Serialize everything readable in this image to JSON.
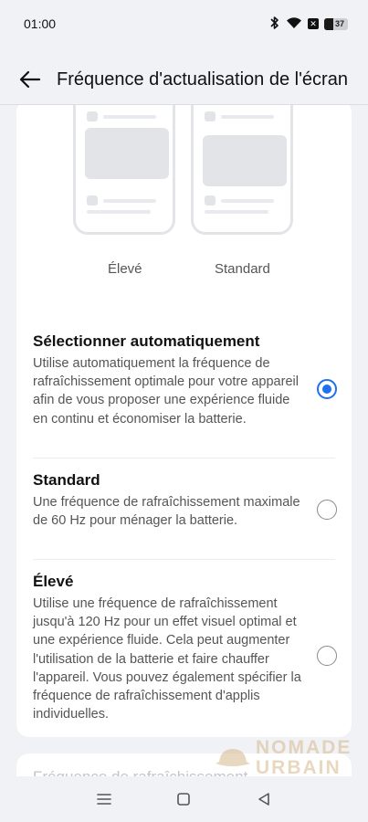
{
  "status_bar": {
    "time": "01:00",
    "battery_level": "37",
    "icons": [
      "bluetooth-icon",
      "wifi-icon",
      "close-box-icon",
      "battery-icon"
    ]
  },
  "header": {
    "back_icon": "arrow-left-icon",
    "title": "Fréquence d'actualisation de l'écran"
  },
  "preview": {
    "labels": [
      "Élevé",
      "Standard"
    ]
  },
  "options": [
    {
      "title": "Sélectionner automatiquement",
      "description": "Utilise automatiquement la fréquence de rafraîchissement optimale pour votre appareil afin de vous proposer une expérience fluide en continu et économiser la batterie.",
      "selected": true
    },
    {
      "title": "Standard",
      "description": "Une fréquence de rafraîchissement maximale de 60 Hz pour ménager la batterie.",
      "selected": false
    },
    {
      "title": "Élevé",
      "description": "Utilise une fréquence de rafraîchissement jusqu'à 120 Hz pour un effet visuel optimal et une expérience fluide. Cela peut augmenter l'utilisation de la batterie et faire chauffer l'appareil. Vous pouvez également spécifier la fréquence de rafraîchissement d'applis individuelles.",
      "selected": false
    }
  ],
  "next_section": {
    "title": "Fréquence de rafraîchissement"
  },
  "watermark": {
    "line1": "NOMADE",
    "line2": "URBAIN"
  },
  "nav_bar": {
    "icons": [
      "menu-icon",
      "home-square-icon",
      "back-triangle-icon"
    ]
  },
  "colors": {
    "accent": "#1f6ff2",
    "background": "#f1f2f6",
    "card": "#ffffff"
  }
}
